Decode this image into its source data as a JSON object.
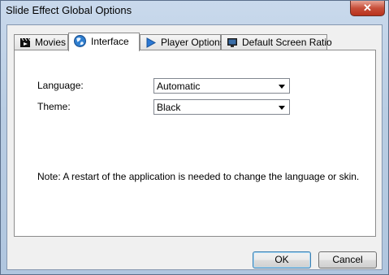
{
  "window": {
    "title": "Slide Effect Global Options",
    "close_glyph": "✕"
  },
  "tabs": [
    {
      "label": "Movies",
      "icon": "film-clapper-icon"
    },
    {
      "label": "Interface",
      "icon": "globe-icon",
      "active": true
    },
    {
      "label": "Player Options",
      "icon": "play-arrow-icon"
    },
    {
      "label": "Default Screen Ratio",
      "icon": "monitor-icon"
    }
  ],
  "interface": {
    "language_label": "Language:",
    "language_value": "Automatic",
    "theme_label": "Theme:",
    "theme_value": "Black",
    "note": "Note: A restart of the application is needed to change the language or skin."
  },
  "buttons": {
    "ok": "OK",
    "cancel": "Cancel"
  },
  "colors": {
    "title_bar": "#b9cde3",
    "close_button": "#c74f3a",
    "dialog_bg": "#f0f0f0",
    "default_button_border": "#3c7fb1"
  }
}
